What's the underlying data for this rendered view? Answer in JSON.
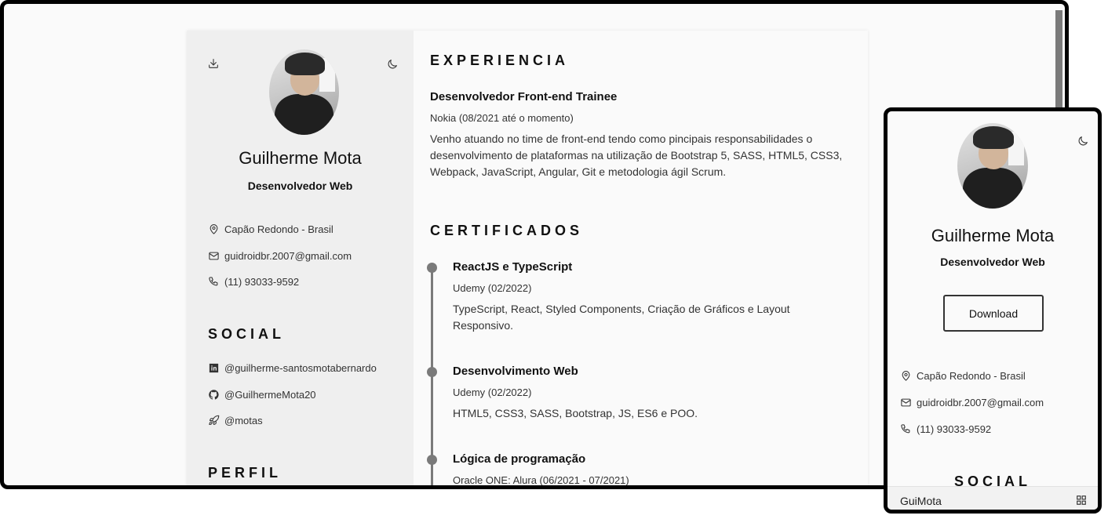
{
  "profile": {
    "name": "Guilherme Mota",
    "role": "Desenvolvedor Web"
  },
  "contact": {
    "location": "Capão Redondo - Brasil",
    "email": "guidroidbr.2007@gmail.com",
    "phone": "(11) 93033-9592"
  },
  "social": {
    "title": "SOCIAL",
    "linkedin": "@guilherme-santosmotabernardo",
    "github": "@GuilhermeMota20",
    "rocketseat": "@motas"
  },
  "perfil_title": "PERFIL",
  "experience": {
    "title": "EXPERIENCIA",
    "jobs": [
      {
        "title": "Desenvolvedor Front-end Trainee",
        "meta": "Nokia (08/2021 até o momento)",
        "desc": "Venho atuando no time de front-end tendo como pincipais responsabilidades o desenvolvimento de plataformas na utilização de Bootstrap 5, SASS, HTML5, CSS3, Webpack, JavaScript, Angular, Git e metodologia ágil Scrum."
      }
    ]
  },
  "certificates": {
    "title": "CERTIFICADOS",
    "items": [
      {
        "title": "ReactJS e TypeScript",
        "meta": "Udemy (02/2022)",
        "desc": "TypeScript, React, Styled Components, Criação de Gráficos e Layout Responsivo."
      },
      {
        "title": "Desenvolvimento Web",
        "meta": "Udemy (02/2022)",
        "desc": "HTML5, CSS3, SASS, Bootstrap, JS, ES6 e POO."
      },
      {
        "title": "Lógica de programação",
        "meta": "Oracle ONE: Alura (06/2021 - 07/2021)",
        "desc": ""
      }
    ]
  },
  "mobile": {
    "download_label": "Download",
    "footer_brand": "GuiMota"
  },
  "icons": {
    "download": "download-icon",
    "theme": "moon-icon",
    "location": "map-pin-icon",
    "email": "mail-icon",
    "phone": "phone-icon",
    "linkedin": "linkedin-icon",
    "github": "github-icon",
    "rocket": "rocket-icon",
    "grid": "grid-icon"
  }
}
